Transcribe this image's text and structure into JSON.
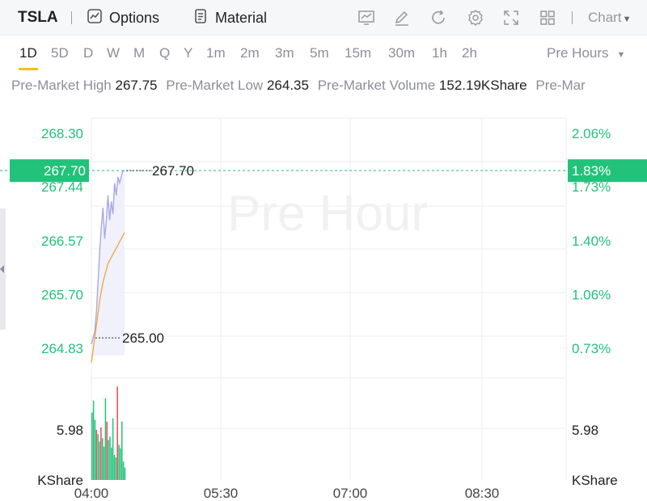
{
  "toolbar": {
    "symbol": "TSLA",
    "options_label": "Options",
    "material_label": "Material",
    "chart_label": "Chart",
    "icons": [
      "chart-style-icon",
      "draw-icon",
      "refresh-icon",
      "settings-icon",
      "fullscreen-icon",
      "layout-grid-icon"
    ]
  },
  "periods": [
    "1D",
    "5D",
    "D",
    "W",
    "M",
    "Q",
    "Y",
    "1m",
    "2m",
    "3m",
    "5m",
    "15m",
    "30m",
    "1h",
    "2h"
  ],
  "active_period": "1D",
  "session_selector": "Pre Hours",
  "stats": [
    {
      "label": "Pre-Market High",
      "value": "267.75"
    },
    {
      "label": "Pre-Market Low",
      "value": "264.35"
    },
    {
      "label": "Pre-Market Volume",
      "value": "152.19KShare"
    },
    {
      "label": "Pre-Mar",
      "value": ""
    }
  ],
  "chart_data": {
    "type": "line",
    "watermark": "Pre Hour",
    "price_ticks": [
      "268.30",
      "267.44",
      "266.57",
      "265.70",
      "264.83"
    ],
    "percent_ticks": [
      "2.06%",
      "1.73%",
      "1.40%",
      "1.06%",
      "0.73%"
    ],
    "ylim": [
      264.35,
      268.55
    ],
    "current_price": "267.70",
    "current_percent": "1.83%",
    "high_marker": {
      "price": 267.7,
      "label": "267.70"
    },
    "low_marker": {
      "price": 265.0,
      "label": "265.00"
    },
    "x_ticks": [
      "04:00",
      "05:30",
      "07:00",
      "08:30"
    ],
    "volume_tick": "5.98",
    "volume_unit": "KShare",
    "volume_unit_right": "KShare",
    "volume_tick_right": "5.98",
    "price_series": [
      264.9,
      265.0,
      265.1,
      265.4,
      265.9,
      266.4,
      266.8,
      267.1,
      266.6,
      266.9,
      267.3,
      266.9,
      267.2,
      267.0,
      267.5,
      267.3,
      267.6,
      267.5,
      267.6,
      267.7,
      267.7
    ],
    "avg_series": [
      264.6,
      264.8,
      265.0,
      265.2,
      265.4,
      265.6,
      265.75,
      265.9,
      266.0,
      266.1,
      266.2,
      266.25,
      266.3,
      266.35,
      266.4,
      266.45,
      266.5,
      266.55,
      266.6,
      266.65,
      266.7
    ],
    "volume_series": [
      8.1,
      9.5,
      7.2,
      6.0,
      5.5,
      4.6,
      6.3,
      5.0,
      4.0,
      9.8,
      7.0,
      4.8,
      5.2,
      3.9,
      7.4,
      3.0,
      2.7,
      11.2,
      4.2,
      3.8,
      7.0,
      2.2,
      1.5
    ],
    "volume_colors": [
      "g",
      "g",
      "g",
      "r",
      "g",
      "g",
      "r",
      "g",
      "g",
      "g",
      "r",
      "g",
      "g",
      "g",
      "g",
      "g",
      "g",
      "r",
      "g",
      "g",
      "g",
      "g",
      "g"
    ],
    "colors": {
      "up": "#22c27a",
      "down": "#f24957",
      "price_line": "#a7a9e6",
      "avg_line": "#f5a23c",
      "axis_text": "#22c27a"
    }
  }
}
